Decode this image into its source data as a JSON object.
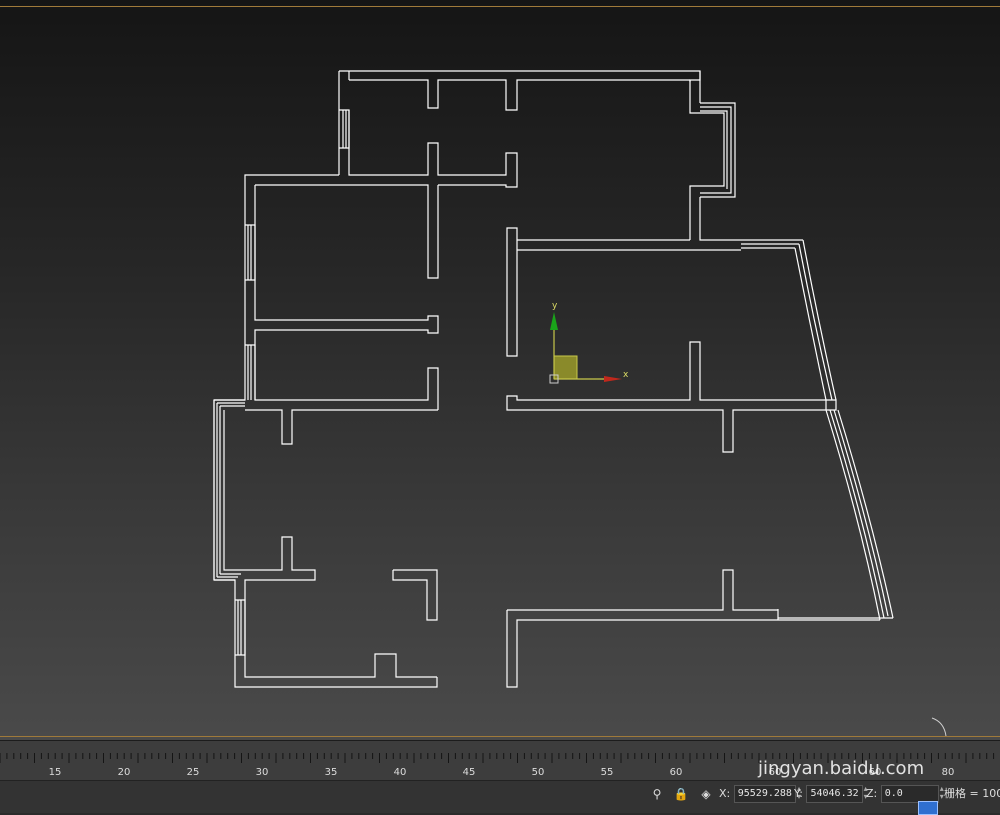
{
  "timeline": {
    "ticks": [
      "15",
      "20",
      "25",
      "30",
      "35",
      "40",
      "45",
      "50",
      "55",
      "60",
      "60",
      "60",
      "80"
    ]
  },
  "gizmo": {
    "x_label": "x",
    "y_label": "y"
  },
  "status": {
    "x_label": "X:",
    "x_value": "95529.288",
    "y_label": "Y:",
    "y_value": "54046.32",
    "z_label": "Z:",
    "z_value": "0.0",
    "grid_text": "栅格 = 100.0"
  },
  "watermark": "jingyan.baidu.com",
  "colors": {
    "wall": "#ffffff",
    "frame": "#a07a3a",
    "gizmo_x": "#c0281c",
    "gizmo_y": "#1aa31a",
    "gizmo_box": "#c8c84a"
  },
  "icons": [
    "pin-icon",
    "lock-icon",
    "selection-icon",
    "prompt-icon"
  ]
}
